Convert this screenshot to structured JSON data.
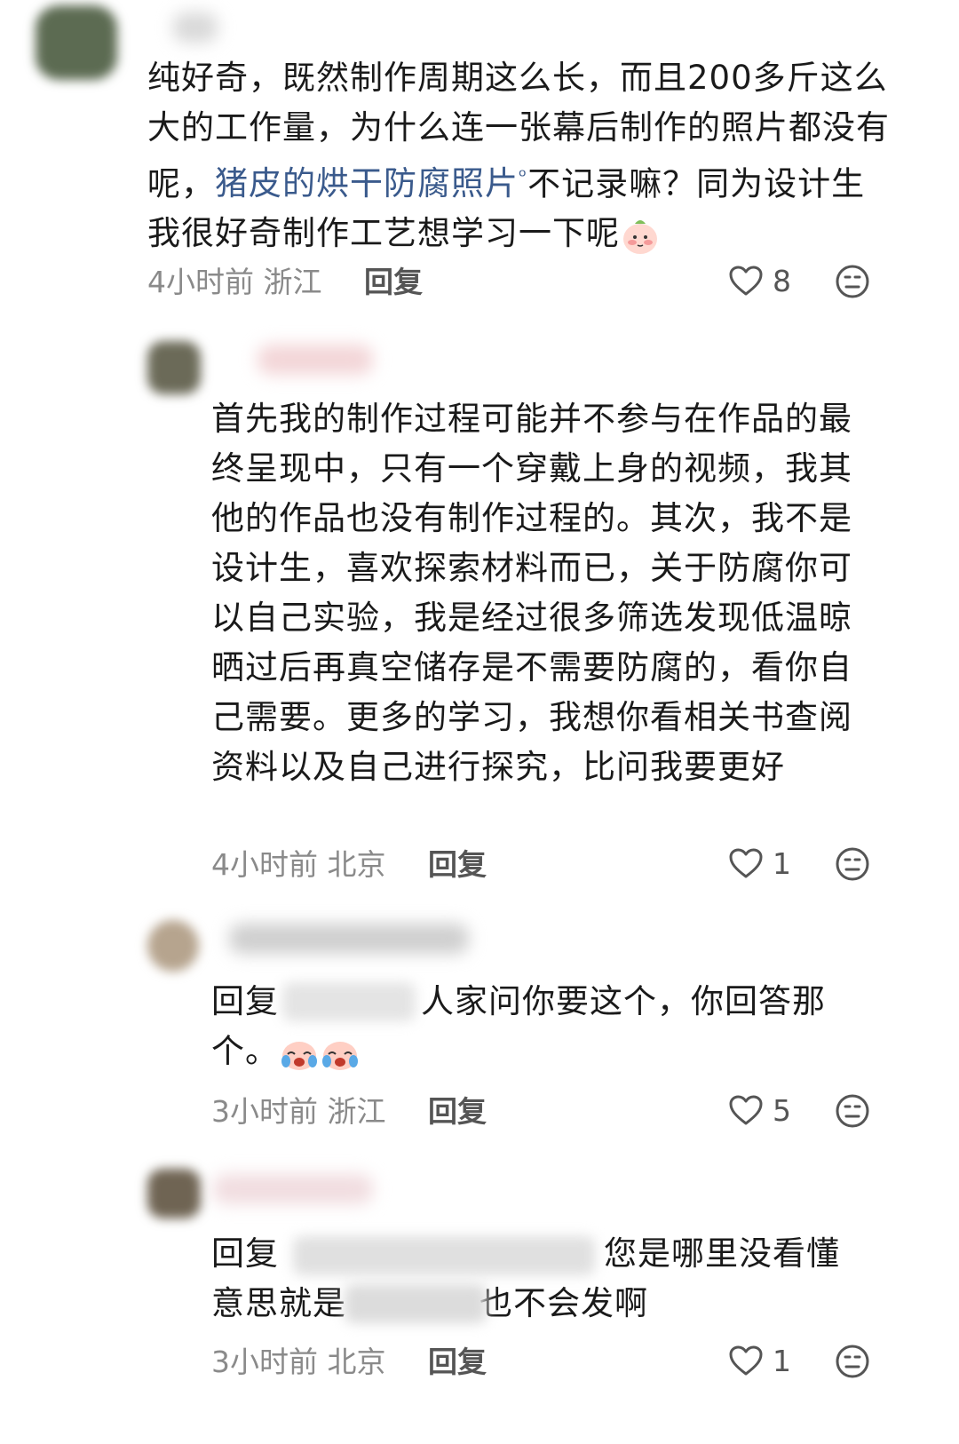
{
  "comments": [
    {
      "text_before_link": "纯好奇，既然制作周期这么长，而且200多斤这么大的工作量，为什么连一张幕后制作的照片都没有呢，",
      "link_text": "猪皮的烘干防腐照片",
      "link_icon": "search-icon",
      "text_after_link": "不记录嘛？同为设计生我很好奇制作工艺想学习一下呢",
      "sticker": "blushing-peach-emoji",
      "time": "4小时前",
      "location": "浙江",
      "reply_label": "回复",
      "likes": "8"
    },
    {
      "text": "首先我的制作过程可能并不参与在作品的最终呈现中，只有一个穿戴上身的视频，我其他的作品也没有制作过程的。其次，我不是设计生，喜欢探索材料而已，关于防腐你可以自己实验，我是经过很多筛选发现低温晾晒过后再真空储存是不需要防腐的，看你自己需要。更多的学习，我想你看相关书查阅资料以及自己进行探究，比问我要更好",
      "time": "4小时前",
      "location": "北京",
      "reply_label": "回复",
      "likes": "1"
    },
    {
      "reply_prefix": "回复",
      "text": "人家问你要这个，你回答那个。",
      "stickers": [
        "crying-laugh-emoji",
        "crying-laugh-emoji"
      ],
      "time": "3小时前",
      "location": "浙江",
      "reply_label": "回复",
      "likes": "5"
    },
    {
      "reply_prefix": "回复",
      "text_line1": "您是哪里没看懂",
      "text_line2_start": "意思就是",
      "text_line2_end": "也不会发啊",
      "time": "3小时前",
      "location": "北京",
      "reply_label": "回复",
      "likes": "1"
    }
  ],
  "icons": {
    "like": "heart-outline-icon",
    "dislike": "neutral-face-icon"
  },
  "colors": {
    "text": "#1a1a1a",
    "meta": "#8a8a8a",
    "link": "#3a5a8c",
    "icon": "#555555"
  }
}
